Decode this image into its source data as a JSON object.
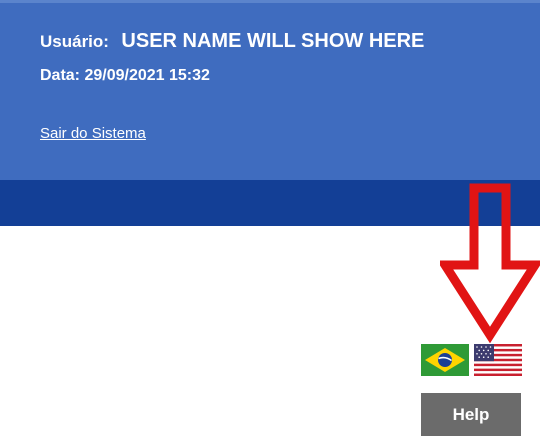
{
  "header": {
    "user_label": "Usuário:",
    "user_name": "USER NAME WILL SHOW HERE",
    "date_text": "Data: 29/09/2021 15:32",
    "logout_link": "Sair do Sistema",
    "panel_color": "#3f6cbf",
    "band_color": "#133f96"
  },
  "language_flags": [
    {
      "icon": "brazil-flag-icon"
    },
    {
      "icon": "usa-flag-icon"
    }
  ],
  "help_button": {
    "label": "Help",
    "color": "#6b6b6b"
  },
  "annotation": {
    "icon": "down-arrow-icon",
    "color": "#e11414"
  }
}
